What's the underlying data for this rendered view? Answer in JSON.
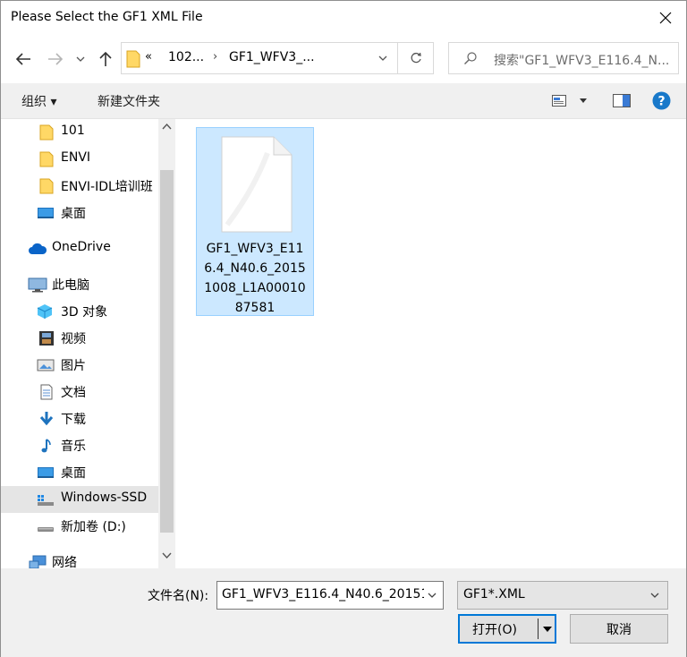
{
  "window": {
    "title": "Please Select the GF1 XML File"
  },
  "nav": {
    "breadcrumb": {
      "overflow": "«",
      "items": [
        "102...",
        "GF1_WFV3_..."
      ]
    },
    "search_placeholder": "搜索\"GF1_WFV3_E116.4_N..."
  },
  "toolbar": {
    "organize_label": "组织 ▾",
    "new_folder_label": "新建文件夹",
    "help_label": "?"
  },
  "sidebar": {
    "items": [
      {
        "label": "101",
        "icon": "folder-icon"
      },
      {
        "label": "ENVI",
        "icon": "folder-icon"
      },
      {
        "label": "ENVI-IDL培训班",
        "icon": "folder-icon"
      },
      {
        "label": "桌面",
        "icon": "desktop-icon"
      },
      {
        "label": "OneDrive",
        "icon": "cloud-icon"
      },
      {
        "label": "此电脑",
        "icon": "computer-icon"
      },
      {
        "label": "3D 对象",
        "icon": "cube-icon"
      },
      {
        "label": "视频",
        "icon": "video-icon"
      },
      {
        "label": "图片",
        "icon": "picture-icon"
      },
      {
        "label": "文档",
        "icon": "document-icon"
      },
      {
        "label": "下载",
        "icon": "download-icon"
      },
      {
        "label": "音乐",
        "icon": "music-icon"
      },
      {
        "label": "桌面",
        "icon": "desktop-icon"
      },
      {
        "label": "Windows-SSD",
        "icon": "drive-icon"
      },
      {
        "label": "新加卷 (D:)",
        "icon": "drive-icon"
      },
      {
        "label": "网络",
        "icon": "network-icon"
      }
    ]
  },
  "files": [
    {
      "name": "GF1_WFV3_E116.4_N40.6_20151008_L1A0001087581",
      "lines": [
        "GF1_WFV3_E11",
        "6.4_N40.6_2015",
        "1008_L1A00010",
        "87581"
      ]
    }
  ],
  "footer": {
    "filename_label": "文件名(N):",
    "filename_value": "GF1_WFV3_E116.4_N40.6_20151",
    "filter_value": "GF1*.XML",
    "open_label": "打开(O)",
    "cancel_label": "取消"
  },
  "colors": {
    "accent": "#0078d7",
    "selection_fill": "#cce8ff",
    "selection_border": "#99d1ff",
    "folder_yellow": "#ffd866",
    "help_blue": "#1979ca"
  }
}
